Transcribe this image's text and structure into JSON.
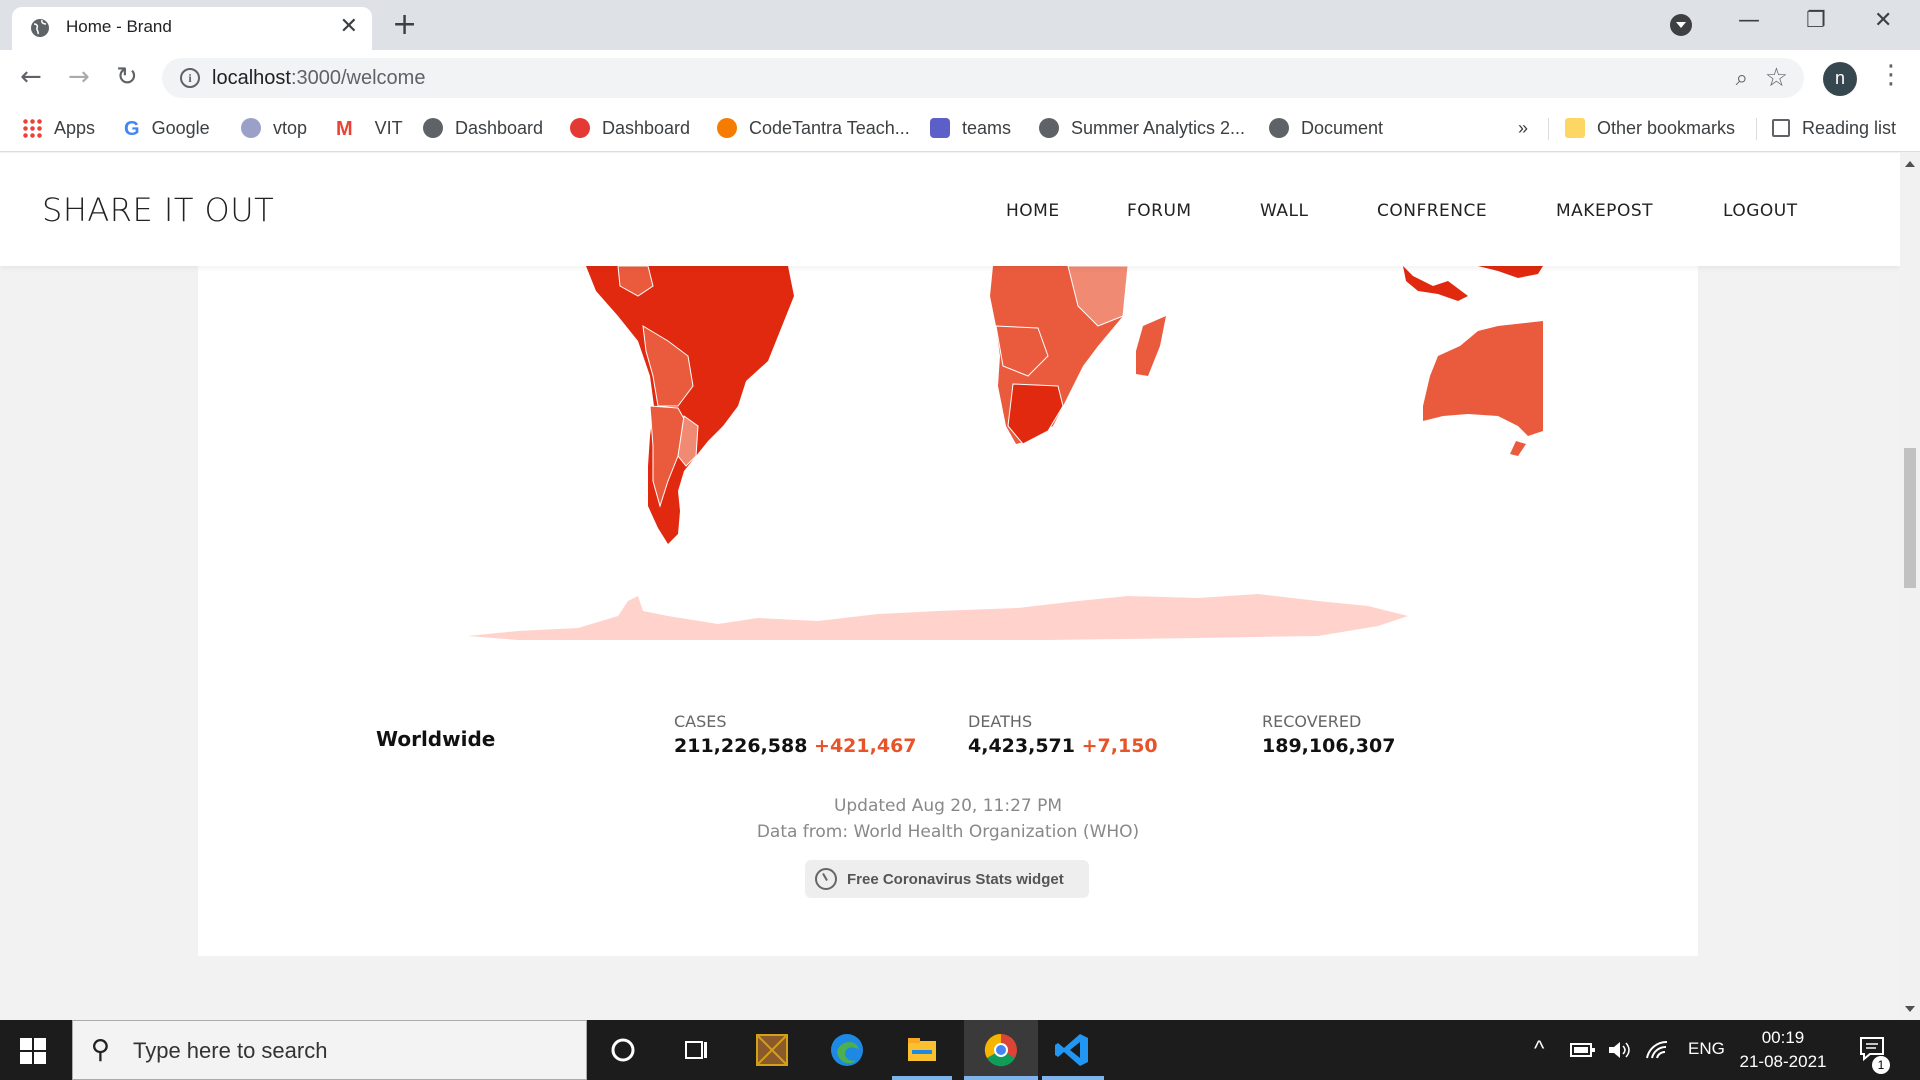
{
  "browser": {
    "tab": {
      "title": "Home - Brand",
      "close": "✕"
    },
    "new_tab": "+",
    "window_controls": {
      "minimize": "—",
      "restore": "❐",
      "close": "✕"
    },
    "nav": {
      "back": "←",
      "forward": "→",
      "reload": "↻"
    },
    "url": {
      "host": "localhost",
      "path": ":3000/welcome"
    },
    "profile_initial": "n",
    "menu": "⋮"
  },
  "bookmarks": {
    "items": [
      {
        "label": "Apps",
        "icon": "apps-grid-icon"
      },
      {
        "label": "Google",
        "icon": "google-icon"
      },
      {
        "label": "vtop",
        "icon": "vtop-icon"
      },
      {
        "label": "VIT",
        "icon": "gmail-icon"
      },
      {
        "label": "Dashboard",
        "icon": "globe-icon"
      },
      {
        "label": "Dashboard",
        "icon": "dashboard-icon"
      },
      {
        "label": "CodeTantra Teach...",
        "icon": "codetantra-icon"
      },
      {
        "label": "teams",
        "icon": "teams-icon"
      },
      {
        "label": "Summer Analytics 2...",
        "icon": "globe-icon"
      },
      {
        "label": "Document",
        "icon": "globe-icon"
      }
    ],
    "overflow": "»",
    "other": "Other bookmarks",
    "reading_list": "Reading list"
  },
  "site": {
    "brand": "SHARE IT OUT",
    "nav": [
      "HOME",
      "FORUM",
      "WALL",
      "CONFRENCE",
      "MAKEPOST",
      "LOGOUT"
    ]
  },
  "covid": {
    "region": "Worldwide",
    "cases": {
      "label": "CASES",
      "value": "211,226,588",
      "delta": "+421,467"
    },
    "deaths": {
      "label": "DEATHS",
      "value": "4,423,571",
      "delta": "+7,150"
    },
    "recovered": {
      "label": "RECOVERED",
      "value": "189,106,307"
    },
    "updated": "Updated Aug 20, 11:27 PM",
    "source": "Data from: World Health Organization (WHO)",
    "widget_button": "Free Coronavirus Stats widget",
    "colors": {
      "high": "#e0290f",
      "mid": "#ea5b3e",
      "low": "#f08a72",
      "antarctica": "#ffd3cc",
      "delta": "#e8542a"
    }
  },
  "taskbar": {
    "search_placeholder": "Type here to search",
    "tray": {
      "language": "ENG",
      "time": "00:19",
      "date": "21-08-2021",
      "notifications": "1"
    }
  }
}
